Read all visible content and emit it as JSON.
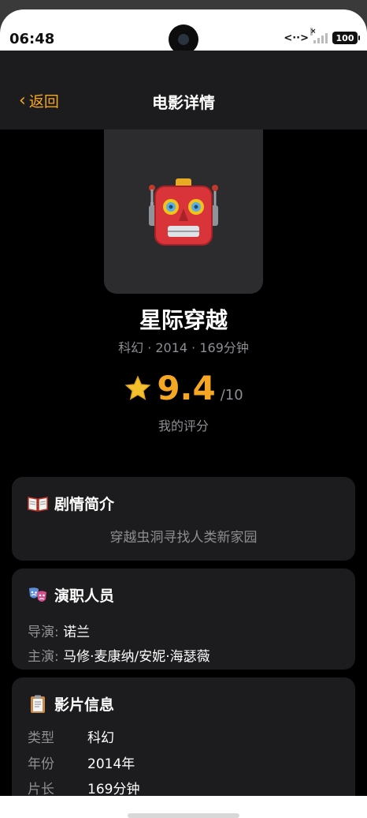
{
  "status_bar": {
    "time": "06:48",
    "battery": "100"
  },
  "nav": {
    "back_label": "返回",
    "title": "电影详情"
  },
  "movie": {
    "poster_icon": "robot-icon",
    "title": "星际穿越",
    "meta": "科幻 · 2014 · 169分钟",
    "rating": "9.4",
    "rating_max": "/10",
    "my_rating_label": "我的评分"
  },
  "synopsis": {
    "heading": "剧情简介",
    "icon": "book-icon",
    "text": "穿越虫洞寻找人类新家园"
  },
  "cast": {
    "heading": "演职人员",
    "icon": "theater-masks-icon",
    "director_label": "导演:",
    "director": "诺兰",
    "stars_label": "主演:",
    "stars": "马修·麦康纳/安妮·海瑟薇"
  },
  "info": {
    "heading": "影片信息",
    "icon": "clipboard-icon",
    "rows": [
      {
        "label": "类型",
        "value": "科幻"
      },
      {
        "label": "年份",
        "value": "2014年"
      },
      {
        "label": "片长",
        "value": "169分钟"
      }
    ]
  },
  "colors": {
    "accent": "#f5a623",
    "card_bg": "#1c1c1e",
    "muted_text": "#8e8e93"
  }
}
